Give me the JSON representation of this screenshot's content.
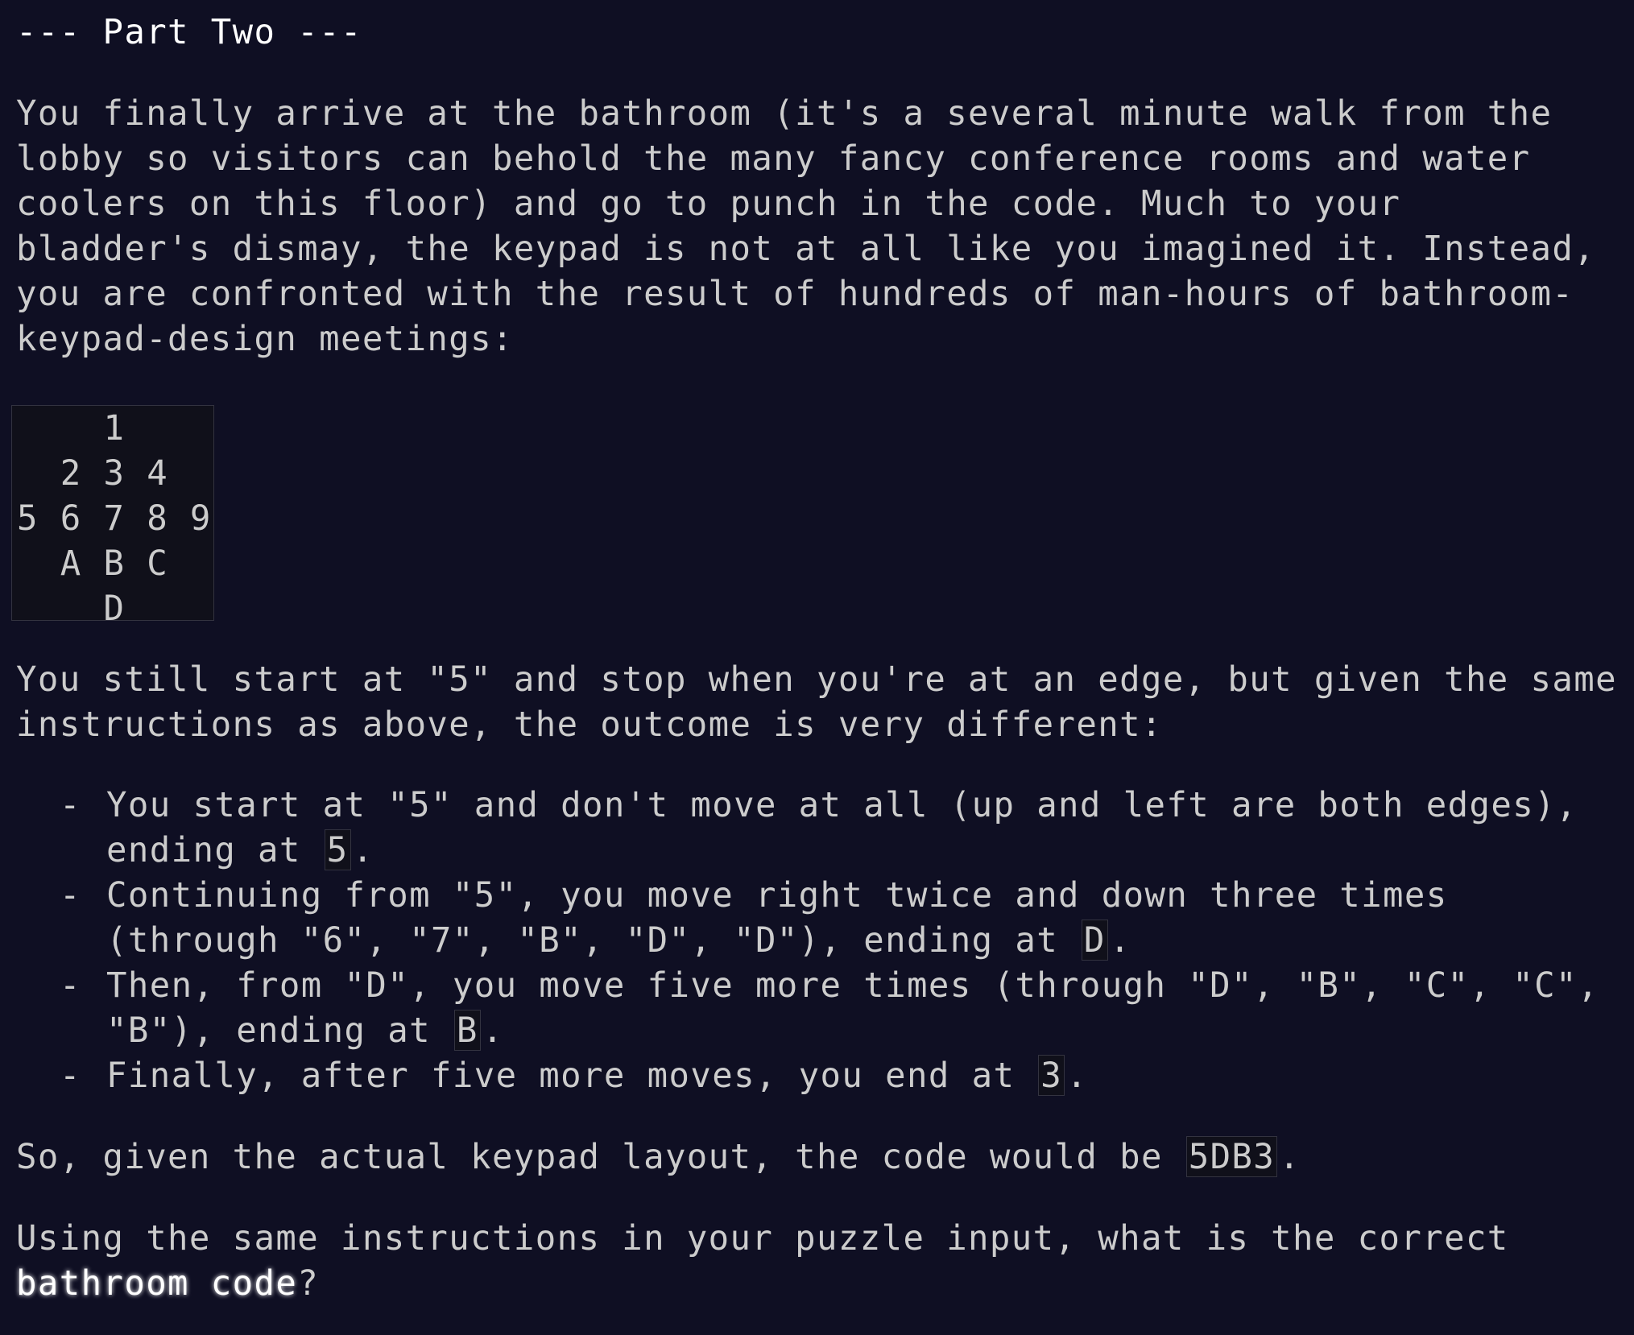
{
  "heading": "--- Part Two ---",
  "intro_paragraph": "You finally arrive at the bathroom (it's a several minute walk from the lobby so visitors can behold the many fancy conference rooms and water coolers on this floor) and go to punch in the code. Much to your bladder's dismay, the keypad is not at all like you imagined it. Instead, you are confronted with the result of hundreds of man-hours of bathroom-keypad-design meetings:",
  "keypad": {
    "rows": [
      "    1    ",
      "  2 3 4  ",
      "5 6 7 8 9",
      "  A B C  ",
      "    D    "
    ]
  },
  "second_paragraph": "You still start at \"5\" and stop when you're at an edge, but given the same instructions as above, the outcome is very different:",
  "list": {
    "dash": "-",
    "items": [
      {
        "text": "You start at \"5\" and don't move at all (up and left are both edges), ending at ",
        "code": "5",
        "tail": "."
      },
      {
        "text": "Continuing from \"5\", you move right twice and down three times (through \"6\", \"7\", \"B\", \"D\", \"D\"), ending at ",
        "code": "D",
        "tail": "."
      },
      {
        "text": "Then, from \"D\", you move five more times (through \"D\", \"B\", \"C\", \"C\", \"B\"), ending at ",
        "code": "B",
        "tail": "."
      },
      {
        "text": "Finally, after five more moves, you end at ",
        "code": "3",
        "tail": "."
      }
    ]
  },
  "conclusion": {
    "text": "So, given the actual keypad layout, the code would be ",
    "code": "5DB3",
    "tail": "."
  },
  "question": {
    "text": "Using the same instructions in your puzzle input, what is the correct ",
    "highlight": "bathroom code",
    "tail": "?"
  }
}
